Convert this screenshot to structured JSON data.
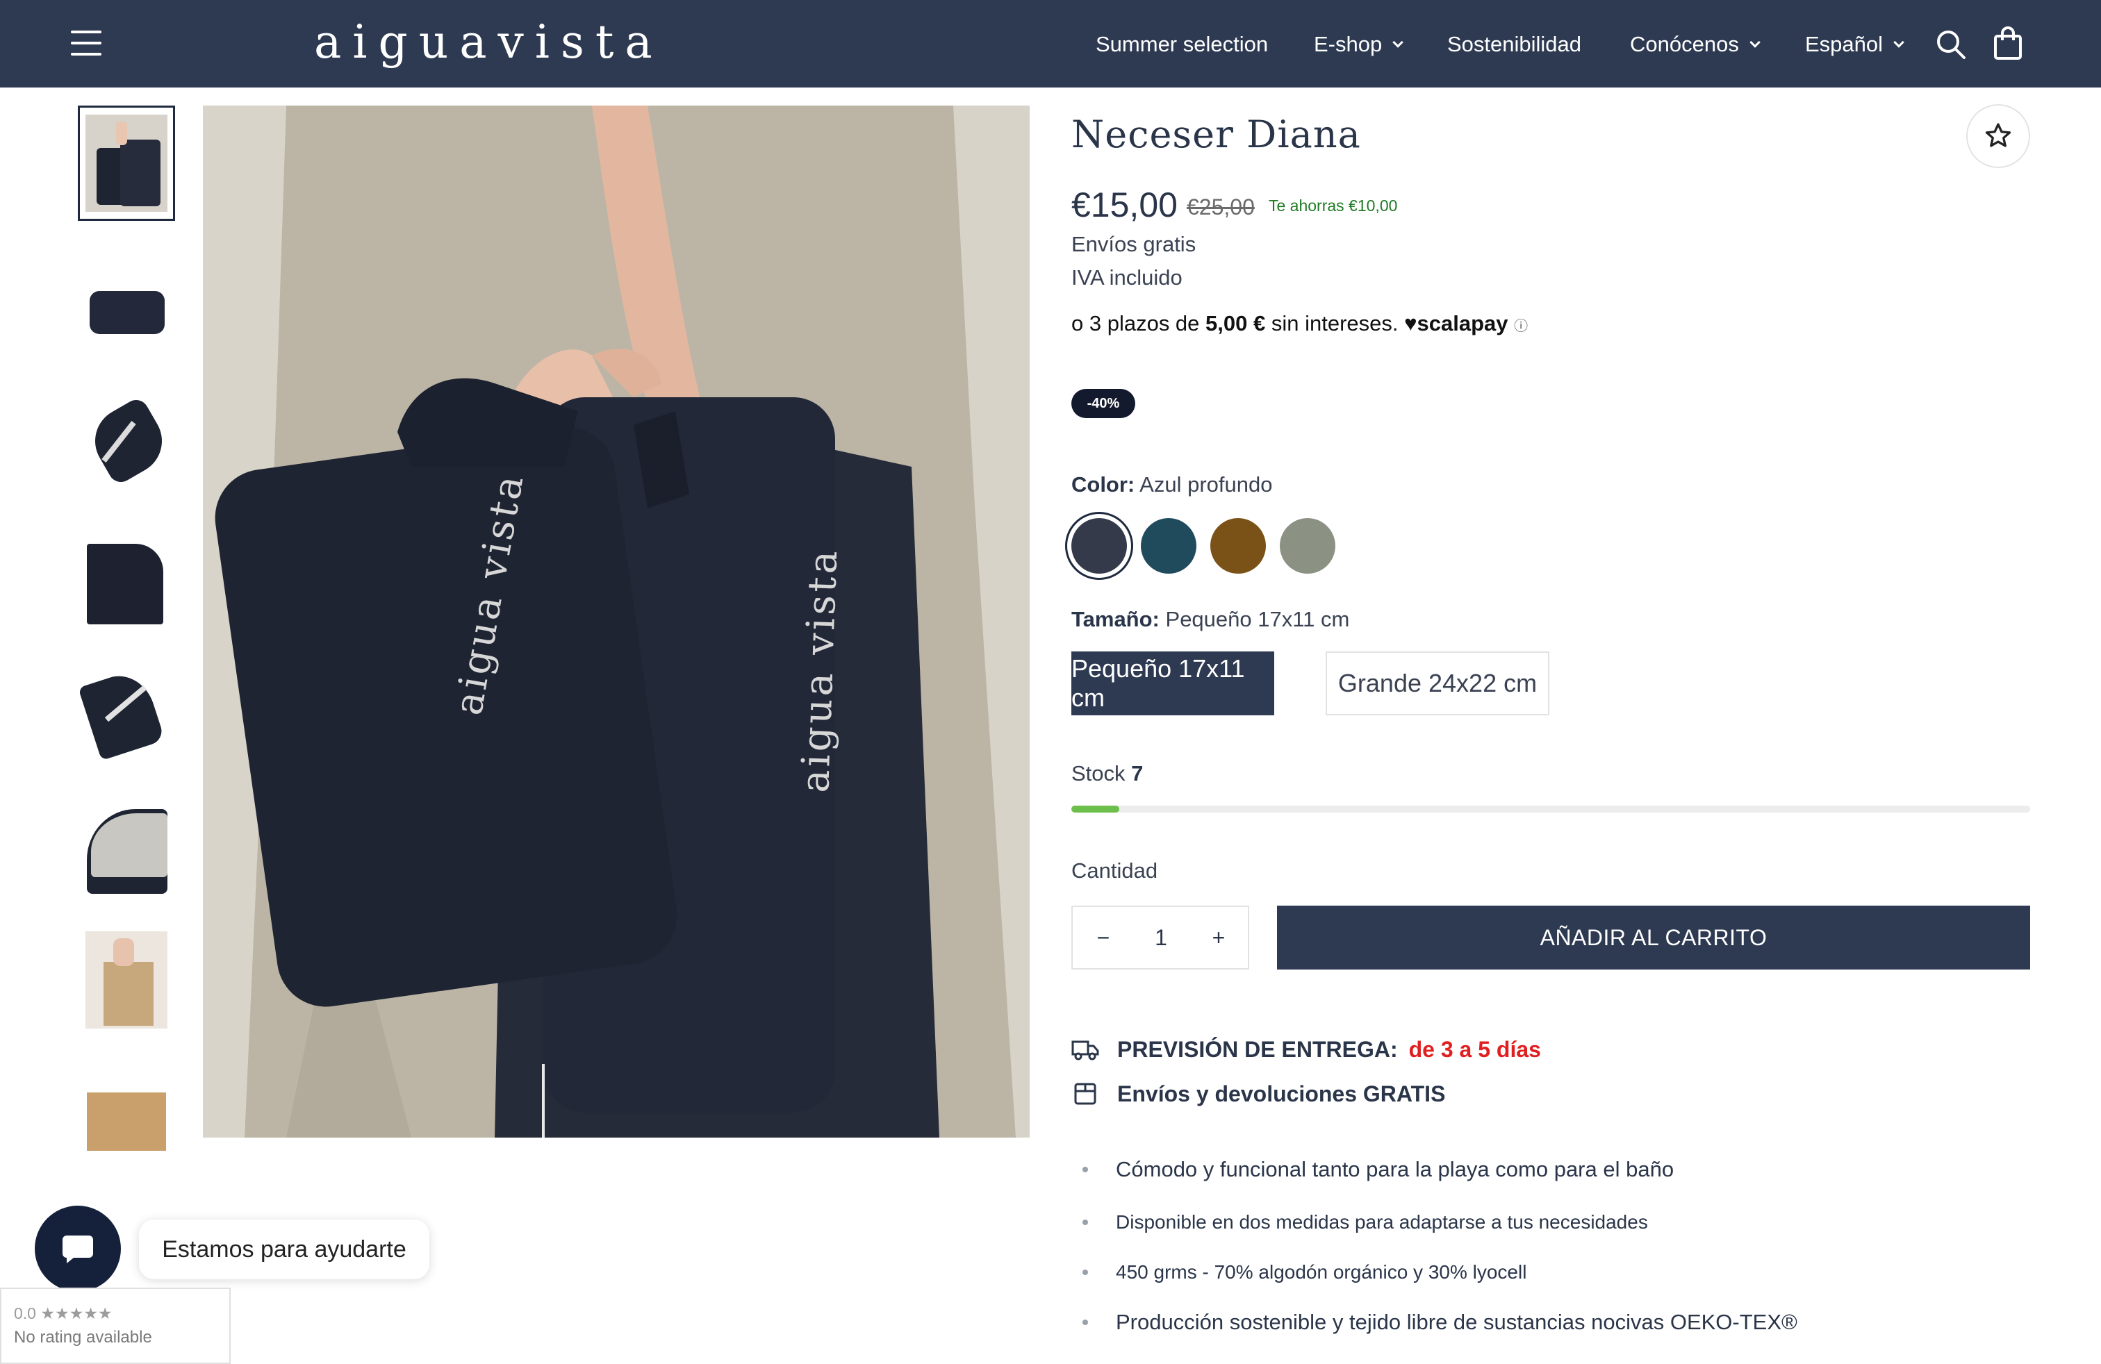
{
  "header": {
    "logo": "aiguavista",
    "nav": [
      {
        "label": "Summer selection",
        "dropdown": false
      },
      {
        "label": "E-shop",
        "dropdown": true
      },
      {
        "label": "Sostenibilidad",
        "dropdown": false
      },
      {
        "label": "Conócenos",
        "dropdown": true
      },
      {
        "label": "Español",
        "dropdown": true
      }
    ],
    "icons": [
      "menu-icon",
      "search-icon",
      "bag-icon"
    ]
  },
  "gallery": {
    "thumbnails": 8,
    "active_index": 0,
    "bag_text": "aigua vista"
  },
  "product": {
    "title": "Neceser Diana",
    "price": "€15,00",
    "old_price": "€25,00",
    "savings": "Te ahorras €10,00",
    "shipping": "Envíos gratis",
    "tax": "IVA incluido",
    "installments": {
      "prefix": "o 3 plazos de",
      "amount": "5,00 €",
      "suffix": "sin intereses.",
      "provider": "scalapay"
    },
    "discount_badge": "-40%",
    "color": {
      "label": "Color:",
      "value": "Azul profundo",
      "swatches": [
        "#343a4a",
        "#1f4b5c",
        "#7a5217",
        "#8b9183"
      ],
      "selected_index": 0
    },
    "size": {
      "label": "Tamaño:",
      "value": "Pequeño 17x11 cm",
      "options": [
        "Pequeño 17x11 cm",
        "Grande 24x22 cm"
      ],
      "selected_index": 0
    },
    "stock": {
      "label": "Stock",
      "value": "7",
      "level_percent": 5
    },
    "quantity": {
      "label": "Cantidad",
      "value": "1",
      "minus": "−",
      "plus": "+"
    },
    "add_to_cart": "AÑADIR AL CARRITO",
    "delivery": {
      "label": "PREVISIÓN DE ENTREGA:",
      "value": "de 3 a 5 días"
    },
    "returns": "Envíos y devoluciones GRATIS",
    "features": [
      "Cómodo y funcional tanto para la playa como para el baño",
      "Disponible en dos medidas para adaptarse a tus necesidades",
      "450 grms - 70% algodón orgánico y 30% lyocell",
      "Producción sostenible y tejido libre de sustancias nocivas OEKO-TEX®"
    ]
  },
  "chat": {
    "label": "Estamos para ayudarte"
  },
  "rating": {
    "score": "0.0 ★★★★★",
    "text": "No rating available"
  },
  "colors": {
    "navy": "#2e3a52",
    "green": "#6cbf4b",
    "red": "#e02020"
  }
}
